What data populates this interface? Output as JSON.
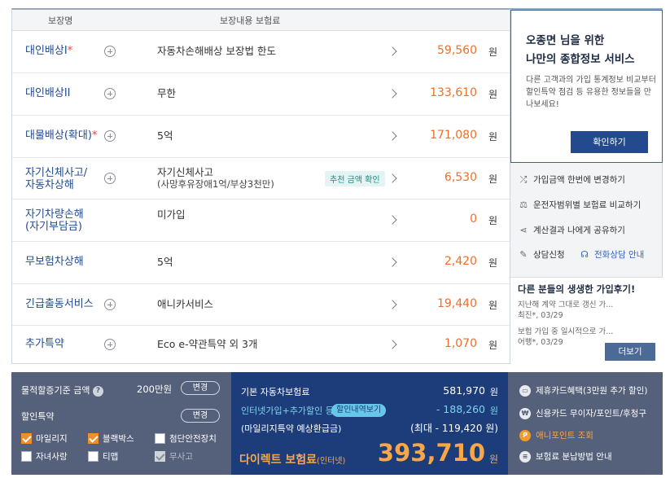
{
  "table": {
    "header_name": "보장명",
    "header_content": "보장내용  보험료",
    "rows": [
      {
        "name": "대인배상I",
        "star": "*",
        "content": "자동차손해배상 보장법 한도",
        "price": "59,560",
        "won": "원"
      },
      {
        "name": "대인배상II",
        "star": "",
        "content": "무한",
        "price": "133,610",
        "won": "원"
      },
      {
        "name": "대물배상(확대)",
        "star": "*",
        "content": "5억",
        "price": "171,080",
        "won": "원"
      },
      {
        "name": "자기신체사고/",
        "name2": "자동차상해",
        "content": "자기신체사고",
        "content2": "(사망후유장애1억/부상3천만)",
        "badge": "추천 금액 확인",
        "price": "6,530",
        "won": "원"
      },
      {
        "name": "자기차량손해",
        "name2": "(자기부담금)",
        "content": "미가입",
        "price": "0",
        "won": "원"
      },
      {
        "name": "무보험차상해",
        "star": "",
        "content": "5억",
        "price": "2,420",
        "won": "원"
      },
      {
        "name": "긴급출동서비스",
        "star": "",
        "content": "애니카서비스",
        "price": "19,440",
        "won": "원"
      },
      {
        "name": "추가특약",
        "star": "",
        "content": "Eco e-약관특약 외 3개",
        "price": "1,070",
        "won": "원"
      }
    ]
  },
  "side": {
    "title1": "오종면 님을 위한",
    "title2": "나만의 종합정보 서비스",
    "desc": "다른 고객과의 가입 통계정보 비교부터 할인특약 점검 등 유용한 정보들을 만나보세요!",
    "confirm_button": "확인하기",
    "links": [
      "가입금액 한번에 변경하기",
      "운전자범위별 보험료 비교하기",
      "계산결과 나에게 공유하기",
      "상담신청",
      "전화상담 안내"
    ],
    "review_title": "다른 분들의 생생한 가입후기!",
    "review1_text": "지난해 계약 그대로 갱신 가...",
    "review1_meta": "최진*, 03/29",
    "review2_text": "보험 가입 중 일시적으로 가...",
    "review2_meta": "어행*, 03/29",
    "more_button": "더보기"
  },
  "bottom": {
    "mileage_label": "물적할증기준 금액",
    "mileage_value": "200만원",
    "change_button": "변경",
    "discount_label": "할인특약",
    "discount_change": "변경",
    "checks": [
      {
        "label": "마일리지",
        "state": "on"
      },
      {
        "label": "블랙박스",
        "state": "on"
      },
      {
        "label": "첨단안전장치",
        "state": "off"
      },
      {
        "label": "자녀사랑",
        "state": "off"
      },
      {
        "label": "티맵",
        "state": "off"
      },
      {
        "label": "무사고",
        "state": "dis"
      }
    ],
    "base_label": "기본 자동차보험료",
    "base_value": "581,970",
    "internet_label": "인터넷가입+추가할인 등",
    "detail_badge": "할인내역보기",
    "discount_value": "- 188,260",
    "mileage_refund_label": "(마일리지특약 예상환급금)",
    "mileage_refund_value": "(최대 - 119,420 원)",
    "won": "원",
    "total_label": "다이렉트 보험료",
    "total_sub": "(인터넷)",
    "total_value": "393,710",
    "right_items": [
      "제휴카드혜택(3만원 추가 할인)",
      "신용카드 무이자/포인트/후청구",
      "애니포인트 조회",
      "보험료 분납방법 안내"
    ]
  }
}
